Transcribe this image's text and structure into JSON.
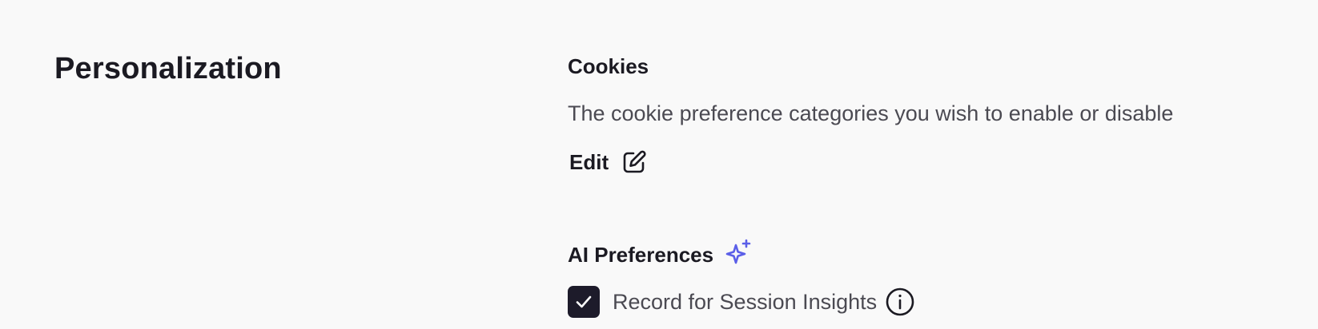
{
  "section": {
    "title": "Personalization"
  },
  "cookies": {
    "heading": "Cookies",
    "description": "The cookie preference categories you wish to enable or disable",
    "edit_label": "Edit",
    "edit_icon": "edit-pencil-square-icon"
  },
  "ai_preferences": {
    "heading": "AI Preferences",
    "heading_icon": "sparkle-icon",
    "accent_color": "#5b5fe8",
    "option": {
      "label": "Record for Session Insights",
      "checked": true,
      "info_icon": "info-icon"
    }
  }
}
